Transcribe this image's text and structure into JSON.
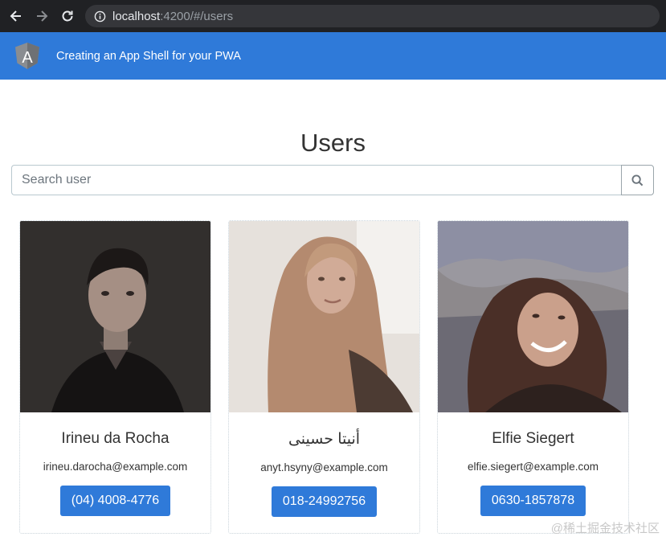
{
  "browser": {
    "url_host": "localhost",
    "url_rest": ":4200/#/users"
  },
  "header": {
    "title": "Creating an App Shell for your PWA",
    "logo_letter": "A"
  },
  "page": {
    "title": "Users"
  },
  "search": {
    "placeholder": "Search user",
    "value": ""
  },
  "users": [
    {
      "name": "Irineu da Rocha",
      "email": "irineu.darocha@example.com",
      "phone": "(04) 4008-4776"
    },
    {
      "name": "أنيتا حسینی",
      "email": "anyt.hsyny@example.com",
      "phone": "018-24992756"
    },
    {
      "name": "Elfie Siegert",
      "email": "elfie.siegert@example.com",
      "phone": "0630-1857878"
    }
  ],
  "watermark": "@稀土掘金技术社区",
  "colors": {
    "accent": "#2f7ad9",
    "browser_bar": "#202124"
  }
}
